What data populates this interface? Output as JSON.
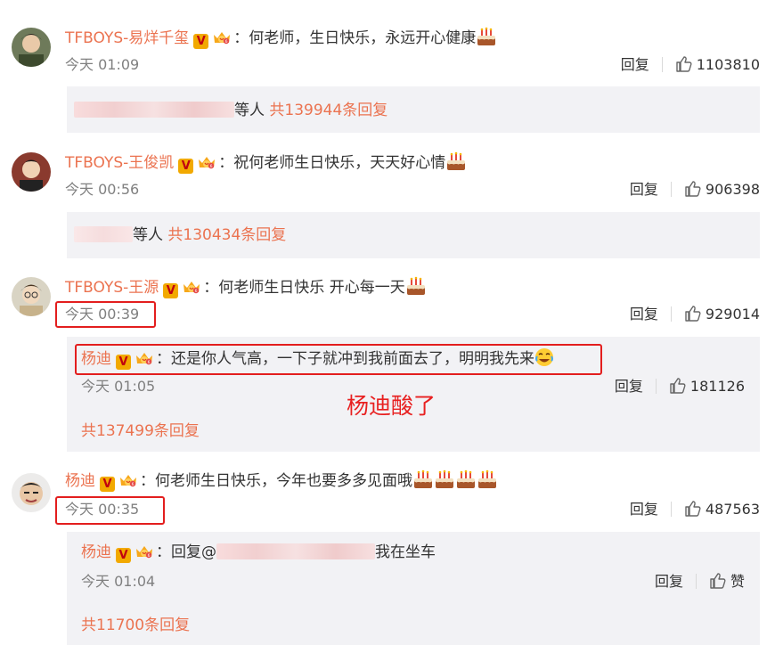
{
  "comments": [
    {
      "user": "TFBOYS-易烊千玺",
      "text": "：何老师，生日快乐，永远开心健康",
      "time": "今天 01:09",
      "reply_label": "回复",
      "likes": "1103810",
      "reply_summary": {
        "suffix": "等人",
        "count": "共139944条回复"
      }
    },
    {
      "user": "TFBOYS-王俊凯",
      "text": "：祝何老师生日快乐，天天好心情",
      "time": "今天 00:56",
      "reply_label": "回复",
      "likes": "906398",
      "reply_summary": {
        "suffix": "等人",
        "count": "共130434条回复"
      }
    },
    {
      "user": "TFBOYS-王源",
      "text": "：何老师生日快乐  开心每一天",
      "time": "今天 00:39",
      "reply_label": "回复",
      "likes": "929014",
      "sub_reply": {
        "user": "杨迪",
        "text": "：还是你人气高，一下子就冲到我前面去了，明明我先来",
        "time": "今天 01:05",
        "reply_label": "回复",
        "likes": "181126",
        "total": "共137499条回复"
      }
    },
    {
      "user": "杨迪",
      "text": "：何老师生日快乐，今年也要多多见面哦",
      "time": "今天 00:35",
      "reply_label": "回复",
      "likes": "487563",
      "sub_reply": {
        "user": "杨迪",
        "text_prefix": "：回复@",
        "text_suffix": "我在坐车",
        "time": "今天 01:04",
        "reply_label": "回复",
        "likes": "赞",
        "total": "共11700条回复"
      }
    }
  ],
  "annotation": "杨迪酸了",
  "colors": {
    "username": "#eb7350",
    "annotation_red": "#e31e1e",
    "reply_bg": "#f2f2f5",
    "meta_gray": "#808080"
  },
  "icons": [
    "verified-v-icon",
    "member-crown-icon",
    "cake-emoji-icon",
    "laugh-cry-emoji-icon",
    "thumbs-up-icon"
  ]
}
